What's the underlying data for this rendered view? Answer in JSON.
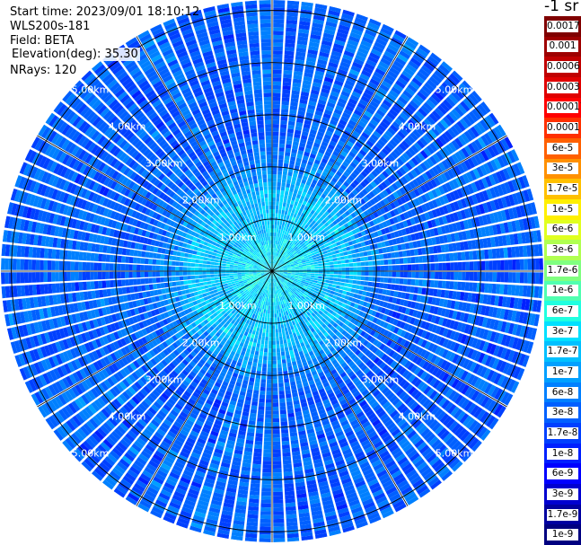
{
  "header": {
    "start_time": "Start time: 2023/09/01 18:10:12",
    "instrument": "WLS200s-181",
    "field": "Field: BETA",
    "elevation": "Elevation(deg): 35.30",
    "nrays": "NRays: 120"
  },
  "colorbar": {
    "unit_label": "-1 sr",
    "labels": [
      "0.0017",
      "0.001",
      "0.0006",
      "0.0003",
      "0.00017",
      "0.0001",
      "6e-5",
      "3e-5",
      "1.7e-5",
      "1e-5",
      "6e-6",
      "3e-6",
      "1.7e-6",
      "1e-6",
      "6e-7",
      "3e-7",
      "1.7e-7",
      "1e-7",
      "6e-8",
      "3e-8",
      "1.7e-8",
      "1e-8",
      "6e-9",
      "3e-9",
      "1.7e-9",
      "1e-9"
    ],
    "colors": [
      "#800000",
      "#9e0000",
      "#c00000",
      "#e00000",
      "#ff0000",
      "#ff3000",
      "#ff6000",
      "#ff9000",
      "#ffc000",
      "#ffef00",
      "#e0ff20",
      "#b0ff50",
      "#80ff80",
      "#50ffb0",
      "#20ffe0",
      "#00e0ff",
      "#00c0ff",
      "#00a0ff",
      "#0080ff",
      "#0060ff",
      "#0040ff",
      "#0020ff",
      "#0000ff",
      "#0000d0",
      "#0000a0",
      "#000080"
    ]
  },
  "chart_data": {
    "type": "heatmap",
    "projection": "polar PPI",
    "rays": 120,
    "ring_labels": [
      "1.00km",
      "2.00km",
      "3.00km",
      "4.00km",
      "5.00km"
    ],
    "range_rings_km": [
      1,
      2,
      3,
      4,
      5
    ],
    "max_range_km": 5.2,
    "radial_profile": {
      "range_km": [
        0,
        0.5,
        1,
        1.5,
        2,
        2.5,
        3,
        3.5,
        4,
        4.5,
        5.2
      ],
      "color_index": [
        15,
        15,
        16,
        16,
        18,
        19,
        19,
        19,
        19,
        19,
        19
      ]
    },
    "grid": true
  }
}
